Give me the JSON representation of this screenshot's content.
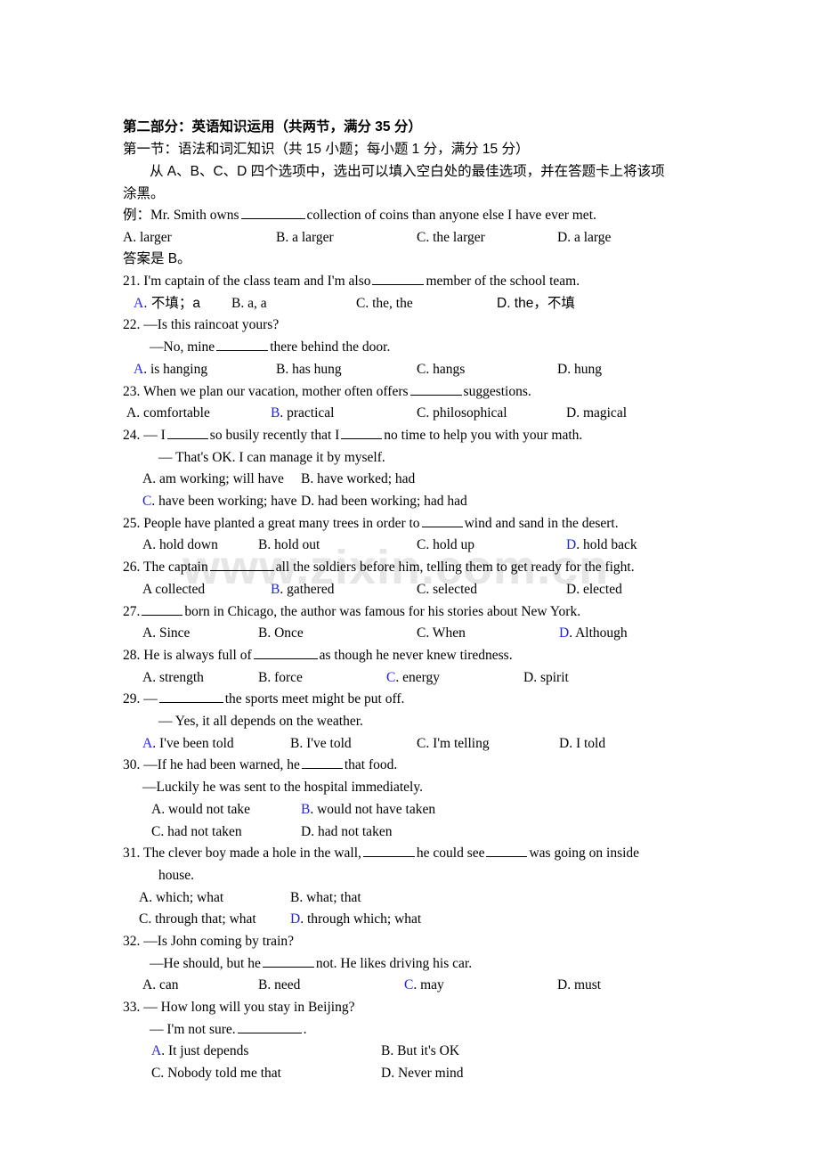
{
  "document": {
    "section_heading": "第二部分：英语知识运用（共两节，满分 35 分）",
    "subsection_heading": "第一节：语法和词汇知识（共 15 小题；每小题 1 分，满分 15 分）",
    "instruction_line1": "从 A、B、C、D 四个选项中，选出可以填入空白处的最佳选项，并在答题卡上将该项",
    "instruction_line2": "涂黑。",
    "example_label": "例：",
    "example_stem_pre": "Mr. Smith owns",
    "example_stem_post": "collection of coins than anyone else I have ever met.",
    "example_options": [
      "A. larger",
      "B. a larger",
      "C. the larger",
      "D. a large"
    ],
    "example_answer": "答案是 B。",
    "watermark": "www.zixin.com.cn"
  },
  "questions": [
    {
      "number": "21.",
      "stem_pre": "I'm captain of the class team and I'm also",
      "stem_post": "member of the school team.",
      "options": [
        "A. 不填；a",
        "B. a, a",
        "C. the, the",
        "D. the，不填"
      ],
      "answer": "A",
      "layout": "four"
    },
    {
      "number": "22.",
      "dialog": [
        "—Is this raincoat yours?"
      ],
      "stem_pre": "—No, mine",
      "stem_post": "there behind the door.",
      "options": [
        "A. is hanging",
        "B. has hung",
        "C. hangs",
        "D. hung"
      ],
      "answer": "A",
      "layout": "four"
    },
    {
      "number": "23.",
      "stem_pre": "When we plan our vacation, mother often offers",
      "stem_post": "suggestions.",
      "options": [
        "A. comfortable",
        "B. practical",
        "C. philosophical",
        "D. magical"
      ],
      "answer": "B",
      "layout": "four"
    },
    {
      "number": "24.",
      "stem_pre": "— I",
      "stem_mid": "so busily recently that I",
      "stem_post": "no time to help you with your math.",
      "reply": "— That's OK. I can manage it by myself.",
      "options": [
        "A. am working; will have",
        "B. have worked; had",
        "C. have been working; have",
        "D. had been working; had had"
      ],
      "answer": "C",
      "layout": "two"
    },
    {
      "number": "25.",
      "stem_pre": "People have planted a great many trees in order to",
      "stem_post": "wind and sand in the desert.",
      "options": [
        "A. hold down",
        "B. hold out",
        "C. hold up",
        "D. hold back"
      ],
      "answer": "D",
      "layout": "four"
    },
    {
      "number": "26.",
      "stem_pre": "The captain",
      "stem_post": "all the soldiers before him, telling them to get ready for the fight.",
      "options": [
        "A collected",
        "B. gathered",
        "C. selected",
        "D. elected"
      ],
      "answer": "B",
      "layout": "four"
    },
    {
      "number": "27.",
      "stem_pre": "",
      "stem_post": "born in Chicago, the author was famous for his stories about New York.",
      "options": [
        "A. Since",
        "B. Once",
        "C. When",
        "D. Although"
      ],
      "answer": "D",
      "layout": "four"
    },
    {
      "number": "28.",
      "stem_pre": "He is always full of",
      "stem_post": "as though he never knew tiredness.",
      "options": [
        "A. strength",
        "B. force",
        "C. energy",
        "D. spirit"
      ],
      "answer": "C",
      "layout": "four"
    },
    {
      "number": "29.",
      "stem_pre": "—",
      "stem_post": "the sports meet might be put off.",
      "reply": "— Yes, it all depends on the weather.",
      "options": [
        "A. I've been told",
        "B. I've told",
        "C. I'm telling",
        "D.   I told"
      ],
      "answer": "A",
      "layout": "four"
    },
    {
      "number": "30.",
      "stem_pre": "—If he had been warned, he",
      "stem_post": "that food.",
      "reply": "—Luckily he was sent to the hospital immediately.",
      "options": [
        "A. would not take",
        "B. would not have taken",
        "C. had not taken",
        "D. had not taken"
      ],
      "answer": "B",
      "layout": "two"
    },
    {
      "number": "31.",
      "stem_pre": "The clever boy made a hole in the wall,",
      "stem_mid": "he could see",
      "stem_post": "was going on inside",
      "stem_wrap": "house.",
      "options": [
        "A. which; what",
        "B. what; that",
        "C. through that; what",
        "D. through which; what"
      ],
      "answer": "D",
      "layout": "two"
    },
    {
      "number": "32.",
      "dialog": [
        "—Is John coming by train?"
      ],
      "stem_pre": "—He should, but he",
      "stem_post": "not. He likes driving his car.",
      "options": [
        "A. can",
        "B. need",
        "C. may",
        "D. must"
      ],
      "answer": "C",
      "layout": "four"
    },
    {
      "number": "33.",
      "dialog": [
        "— How long will you stay in Beijing?"
      ],
      "stem_pre": "— I'm not sure.",
      "stem_post": ".",
      "options": [
        "A. It just depends",
        "B. But it's OK",
        "C. Nobody told me that",
        "D. Never mind"
      ],
      "answer": "A",
      "layout": "two"
    }
  ]
}
